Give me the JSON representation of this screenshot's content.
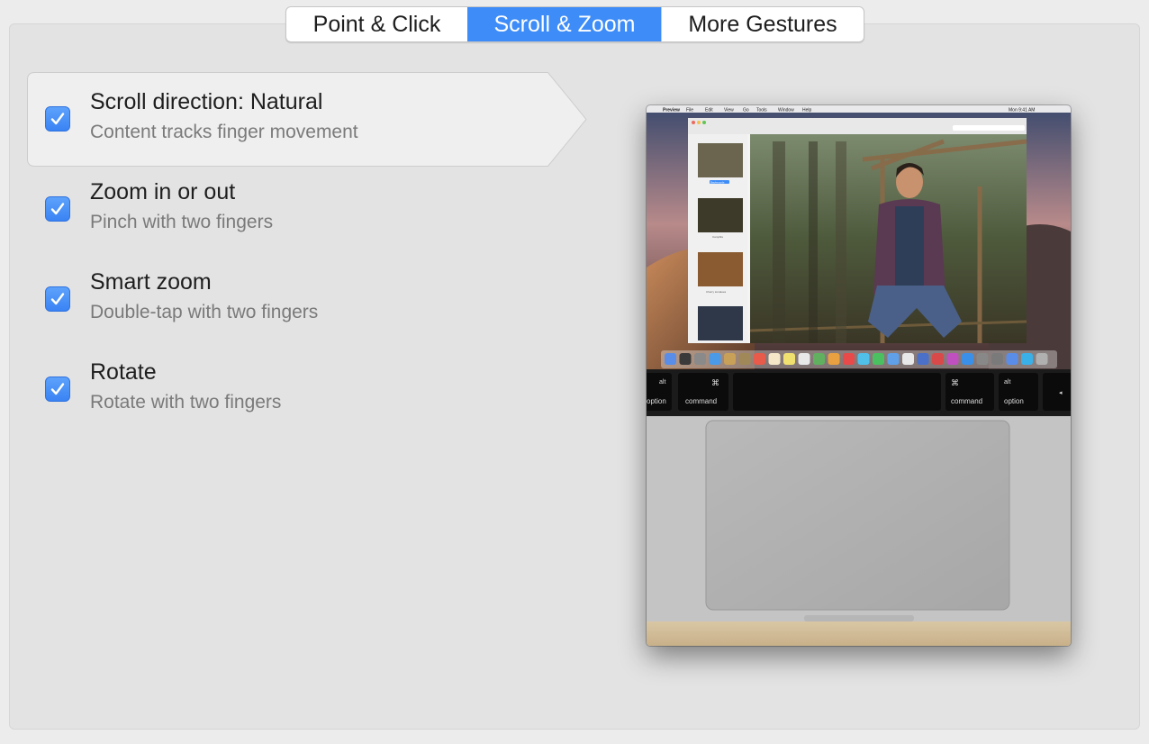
{
  "tabs": [
    {
      "label": "Point & Click",
      "active": false
    },
    {
      "label": "Scroll & Zoom",
      "active": true
    },
    {
      "label": "More Gestures",
      "active": false
    }
  ],
  "options": [
    {
      "title": "Scroll direction: Natural",
      "subtitle": "Content tracks finger movement",
      "checked": true,
      "selected": true
    },
    {
      "title": "Zoom in or out",
      "subtitle": "Pinch with two fingers",
      "checked": true,
      "selected": false
    },
    {
      "title": "Smart zoom",
      "subtitle": "Double-tap with two fingers",
      "checked": true,
      "selected": false
    },
    {
      "title": "Rotate",
      "subtitle": "Rotate with two fingers",
      "checked": true,
      "selected": false
    }
  ],
  "preview": {
    "keys": {
      "left_alt": "alt",
      "left_option": "option",
      "left_command_symbol": "⌘",
      "left_command": "command",
      "right_command_symbol": "⌘",
      "right_command": "command",
      "right_alt": "alt",
      "right_option": "option",
      "arrow": "◂"
    },
    "menubar": {
      "app": "Preview",
      "items": [
        "File",
        "Edit",
        "View",
        "Go",
        "Tools",
        "Window",
        "Help"
      ],
      "clock": "Mon 9:41 AM"
    },
    "thumbnail_captions": [
      "Backwoods",
      "Campfire",
      "Cherry tomatoes"
    ]
  },
  "colors": {
    "accent": "#3e8cf7",
    "panel": "#e3e3e3",
    "selected_row": "#efefef"
  }
}
